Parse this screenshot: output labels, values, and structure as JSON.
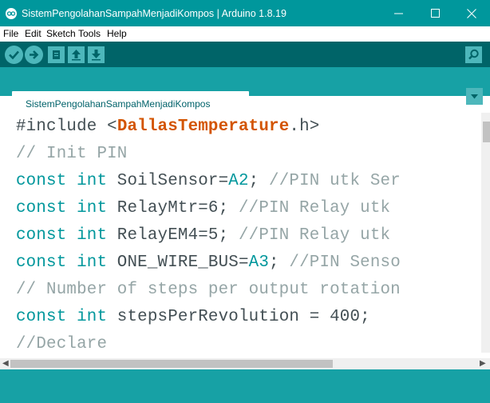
{
  "window": {
    "title": "SistemPengolahanSampahMenjadiKompos | Arduino 1.8.19",
    "minimize_glyph": "—",
    "maximize_glyph": "☐",
    "close_glyph": "✕"
  },
  "menu": [
    "File",
    "Edit",
    "Sketch",
    "Tools",
    "Help"
  ],
  "toolbar": {
    "buttons": [
      "verify-icon",
      "upload-icon",
      "new-icon",
      "open-icon",
      "save-icon"
    ],
    "serial_monitor_icon": "magnifier-icon"
  },
  "tabs": [
    {
      "label": "SistemPengolahanSampahMenjadiKompos",
      "active": true
    }
  ],
  "code": {
    "line1": {
      "include": "#include <",
      "lib": "DallasTemperature",
      "tail": ".h>"
    },
    "line2": "// Init PIN",
    "line3": {
      "kw": "const int",
      "name": " SoilSensor=",
      "pin": "A2",
      "rest": ";",
      "comment": " //PIN utk Ser"
    },
    "line4": {
      "kw": "const int",
      "name": " RelayMtr=6;",
      "comment": " //PIN Relay utk"
    },
    "line5": {
      "kw": "const int",
      "name": " RelayEM4=5;",
      "comment": " //PIN Relay utk"
    },
    "line6": {
      "kw": "const int",
      "name": " ONE_WIRE_BUS=",
      "pin": "A3",
      "rest": ";",
      "comment": " //PIN Senso"
    },
    "line7": "// Number of steps per output rotation",
    "line8": {
      "kw": "const int",
      "name": " stepsPerRevolution = 400;"
    },
    "line9": "//Declare"
  },
  "colors": {
    "titlebar": "#00979c",
    "toolbar": "#006468",
    "tabbar": "#17a1a5",
    "keyword": "#00979c",
    "comment": "#95a5a6",
    "library": "#d35400"
  }
}
